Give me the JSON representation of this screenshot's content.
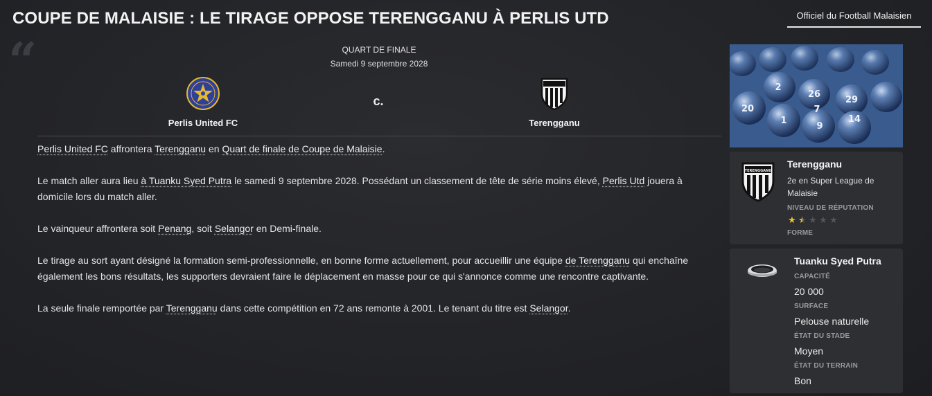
{
  "header": {
    "title": "COUPE DE MALAISIE : LE TIRAGE OPPOSE TERENGGANU À PERLIS UTD",
    "source_tab": "Officiel du Football Malaisien"
  },
  "match": {
    "round": "QUART DE FINALE",
    "date": "Samedi 9 septembre 2028",
    "home": "Perlis United FC",
    "versus": "c.",
    "away": "Terengganu"
  },
  "article": {
    "p1": {
      "team1": "Perlis United FC",
      "t1": " affrontera ",
      "team2": "Terengganu",
      "t2": " en ",
      "stage": "Quart de finale de Coupe de Malaisie",
      "t3": "."
    },
    "p2": {
      "t1": "Le match aller aura lieu ",
      "venue": "à Tuanku Syed Putra",
      "t2": " le samedi 9 septembre 2028. Possédant un classement de tête de série moins élevé, ",
      "team": "Perlis Utd",
      "t3": " jouera à domicile lors du match aller."
    },
    "p3": {
      "t1": "Le vainqueur affrontera soit ",
      "team1": "Penang",
      "t2": ", soit ",
      "team2": "Selangor",
      "t3": " en Demi-finale."
    },
    "p4": {
      "t1": "Le tirage au sort ayant désigné la formation semi-professionnelle, en bonne forme actuellement, pour accueillir une équipe ",
      "team": "de Terengganu",
      "t2": " qui enchaîne également les bons résultats, les supporters devraient faire le déplacement en masse pour ce qui s'annonce comme une rencontre captivante."
    },
    "p5": {
      "t1": "La seule finale remportée par ",
      "team1": "Terengganu",
      "t2": " dans cette compétition en 72 ans remonte à 2001. Le tenant du titre est ",
      "team2": "Selangor",
      "t3": "."
    }
  },
  "photo": {
    "ball_numbers": [
      "2",
      "26",
      "29",
      "20",
      "1",
      "7",
      "9",
      "14"
    ]
  },
  "club_card": {
    "name": "Terengganu",
    "description": "2e en Super League de Malaisie",
    "reputation_label": "NIVEAU DE RÉPUTATION",
    "reputation_stars": 1.5,
    "reputation_max": 5,
    "form_label": "FORME",
    "crest_text": "TERENGGANU"
  },
  "stadium_card": {
    "name": "Tuanku Syed Putra",
    "capacity_label": "CAPACITÉ",
    "capacity": "20 000",
    "surface_label": "SURFACE",
    "surface": "Pelouse naturelle",
    "stadium_state_label": "ÉTAT DU STADE",
    "stadium_state": "Moyen",
    "pitch_state_label": "ÉTAT DU TERRAIN",
    "pitch_state": "Bon"
  },
  "colors": {
    "background": "#232428",
    "panel": "#2e2f33",
    "label": "#9a9ba0",
    "star_filled": "#f2c230",
    "star_empty": "#55565b",
    "perlis_blue": "#2f3f9a",
    "perlis_gold": "#e1b82e"
  }
}
